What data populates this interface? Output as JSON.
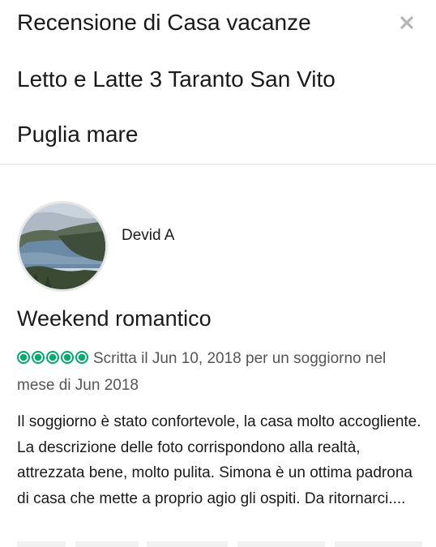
{
  "modal": {
    "title_lines": [
      "Recensione di Casa vacanze",
      "Letto e Latte 3 Taranto San Vito",
      "Puglia mare"
    ],
    "close_icon": "close-icon"
  },
  "review": {
    "author": "Devid A",
    "avatar_icon": "lake-landscape-avatar",
    "title": "Weekend romantico",
    "rating": 5,
    "rating_max": 5,
    "rating_color": "#00aa6c",
    "meta": "Scritta il Jun 10, 2018 per un soggiorno nel mese di Jun 2018",
    "body": "Il soggiorno è stato confortevole, la casa molto accogliente. La descrizione delle foto corrispondono alla realtà, attrezzata bene, molto pulita. Simona è un ottima padrona di casa che mette a proprio agio gli ospiti. Da ritornarci...."
  }
}
